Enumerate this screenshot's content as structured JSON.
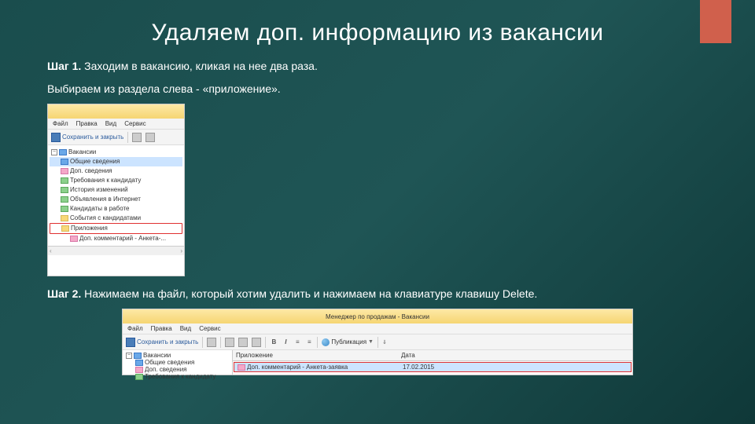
{
  "slide": {
    "title": "Удаляем доп. информацию из вакансии",
    "step1_label": "Шаг 1.",
    "step1_text_a": " Заходим в вакансию, кликая на нее два раза.",
    "step1_text_b": "Выбираем из раздела слева - «приложение».",
    "step2_label": "Шаг 2.",
    "step2_text": " Нажимаем на файл, который хотим удалить и нажимаем на клавиатуре клавишу Delete."
  },
  "shot1": {
    "menu": [
      "Файл",
      "Правка",
      "Вид",
      "Сервис"
    ],
    "save": "Сохранить и закрыть",
    "tree": [
      {
        "label": "Вакансии",
        "cls": "ic blue",
        "sq": "−",
        "ind": 0
      },
      {
        "label": "Общие сведения",
        "cls": "ic blue",
        "ind": 1,
        "sel": true
      },
      {
        "label": "Доп. сведения",
        "cls": "ic pink",
        "ind": 1
      },
      {
        "label": "Требования к кандидату",
        "cls": "ic green",
        "ind": 1
      },
      {
        "label": "История изменений",
        "cls": "ic green",
        "ind": 1
      },
      {
        "label": "Объявления в Интернет",
        "cls": "ic green",
        "ind": 1
      },
      {
        "label": "Кандидаты в работе",
        "cls": "ic green",
        "ind": 1
      },
      {
        "label": "События с кандидатами",
        "cls": "ic yellow",
        "ind": 1
      },
      {
        "label": "Приложения",
        "cls": "ic folder",
        "ind": 1,
        "hl": true
      },
      {
        "label": "Доп. комментарий - Анкета-...",
        "cls": "ic pink",
        "ind": 2
      }
    ],
    "scroll_left": "‹",
    "scroll_right": "›"
  },
  "shot2": {
    "title": "Менеджер по продажам - Вакансии",
    "menu": [
      "Файл",
      "Правка",
      "Вид",
      "Сервис"
    ],
    "save": "Сохранить и закрыть",
    "publish": "Публикация",
    "tree": [
      {
        "label": "Вакансии",
        "cls": "ic blue",
        "sq": "−",
        "ind": 0
      },
      {
        "label": "Общие сведения",
        "cls": "ic blue",
        "ind": 1
      },
      {
        "label": "Доп. сведения",
        "cls": "ic pink",
        "ind": 1
      },
      {
        "label": "Требования к кандидату",
        "cls": "ic green",
        "ind": 1
      }
    ],
    "col1": "Приложение",
    "col2": "Дата",
    "row_name": "Доп. комментарий - Анкета-заявка",
    "row_date": "17.02.2015"
  }
}
